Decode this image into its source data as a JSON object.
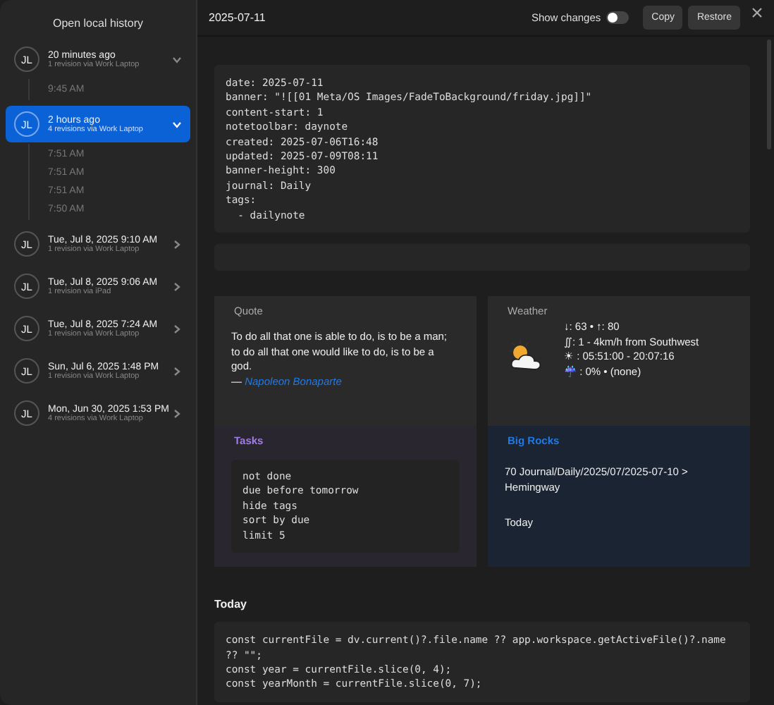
{
  "sidebar": {
    "title": "Open local history",
    "items": [
      {
        "avatar": "JL",
        "title": "20 minutes ago",
        "subtitle": "1 revision via Work Laptop",
        "expanded": true,
        "selected": false,
        "children": [
          {
            "time": "9:45 AM"
          }
        ]
      },
      {
        "avatar": "JL",
        "title": "2 hours ago",
        "subtitle": "4 revisions via Work Laptop",
        "expanded": true,
        "selected": true,
        "children": [
          {
            "time": "7:51 AM"
          },
          {
            "time": "7:51 AM"
          },
          {
            "time": "7:51 AM"
          },
          {
            "time": "7:50 AM"
          }
        ]
      },
      {
        "avatar": "JL",
        "title": "Tue, Jul 8, 2025 9:10 AM",
        "subtitle": "1 revision via Work Laptop",
        "expanded": false,
        "selected": false
      },
      {
        "avatar": "JL",
        "title": "Tue, Jul 8, 2025 9:06 AM",
        "subtitle": "1 revision via iPad",
        "expanded": false,
        "selected": false
      },
      {
        "avatar": "JL",
        "title": "Tue, Jul 8, 2025 7:24 AM",
        "subtitle": "1 revision via Work Laptop",
        "expanded": false,
        "selected": false
      },
      {
        "avatar": "JL",
        "title": "Sun, Jul 6, 2025 1:48 PM",
        "subtitle": "1 revision via Work Laptop",
        "expanded": false,
        "selected": false
      },
      {
        "avatar": "JL",
        "title": "Mon, Jun 30, 2025 1:53 PM",
        "subtitle": "4 revisions via Work Laptop",
        "expanded": false,
        "selected": false
      }
    ]
  },
  "header": {
    "title": "2025-07-11",
    "toggle": {
      "label": "Show changes",
      "on": false
    },
    "buttons": [
      "Copy",
      "Restore"
    ]
  },
  "content": {
    "frontmatter": [
      "date: 2025-07-11",
      "banner: \"![[01 Meta/OS Images/FadeToBackground/friday.jpg]]\"",
      "content-start: 1",
      "notetoolbar: daynote",
      "created: 2025-07-06T16:48",
      "updated: 2025-07-09T08:11",
      "banner-height: 300",
      "journal: Daily",
      "tags:",
      "  - dailynote"
    ],
    "callouts": [
      {
        "kind": "quote",
        "title": "Quote",
        "text": "To do all that one is able to do, is to be a man; to do all that one would like to do, is to be a god.",
        "dash": "—",
        "author": "Napoleon Bonaparte"
      },
      {
        "kind": "weather",
        "title": "Weather",
        "lines": [
          "↓: 63 • ↑: 80",
          "∬: 1 - 4km/h from Southwest",
          "☀ : 05:51:00 - 20:07:16",
          "☔ : 0% • (none)"
        ]
      },
      {
        "kind": "tasks",
        "title": "Tasks",
        "code": [
          "not done",
          "due before tomorrow",
          "hide tags",
          "sort by due",
          "limit 5"
        ]
      },
      {
        "kind": "rocks",
        "title": "Big Rocks",
        "lines": [
          "70 Journal/Daily/2025/07/2025-07-10 > Hemingway",
          "Today"
        ]
      }
    ],
    "heading": "Today",
    "code": [
      "const currentFile = dv.current()?.file.name ?? app.workspace.getActiveFile()?.name ?? \"\";",
      "const year = currentFile.slice(0, 4);",
      "const yearMonth = currentFile.slice(0, 7);"
    ]
  }
}
